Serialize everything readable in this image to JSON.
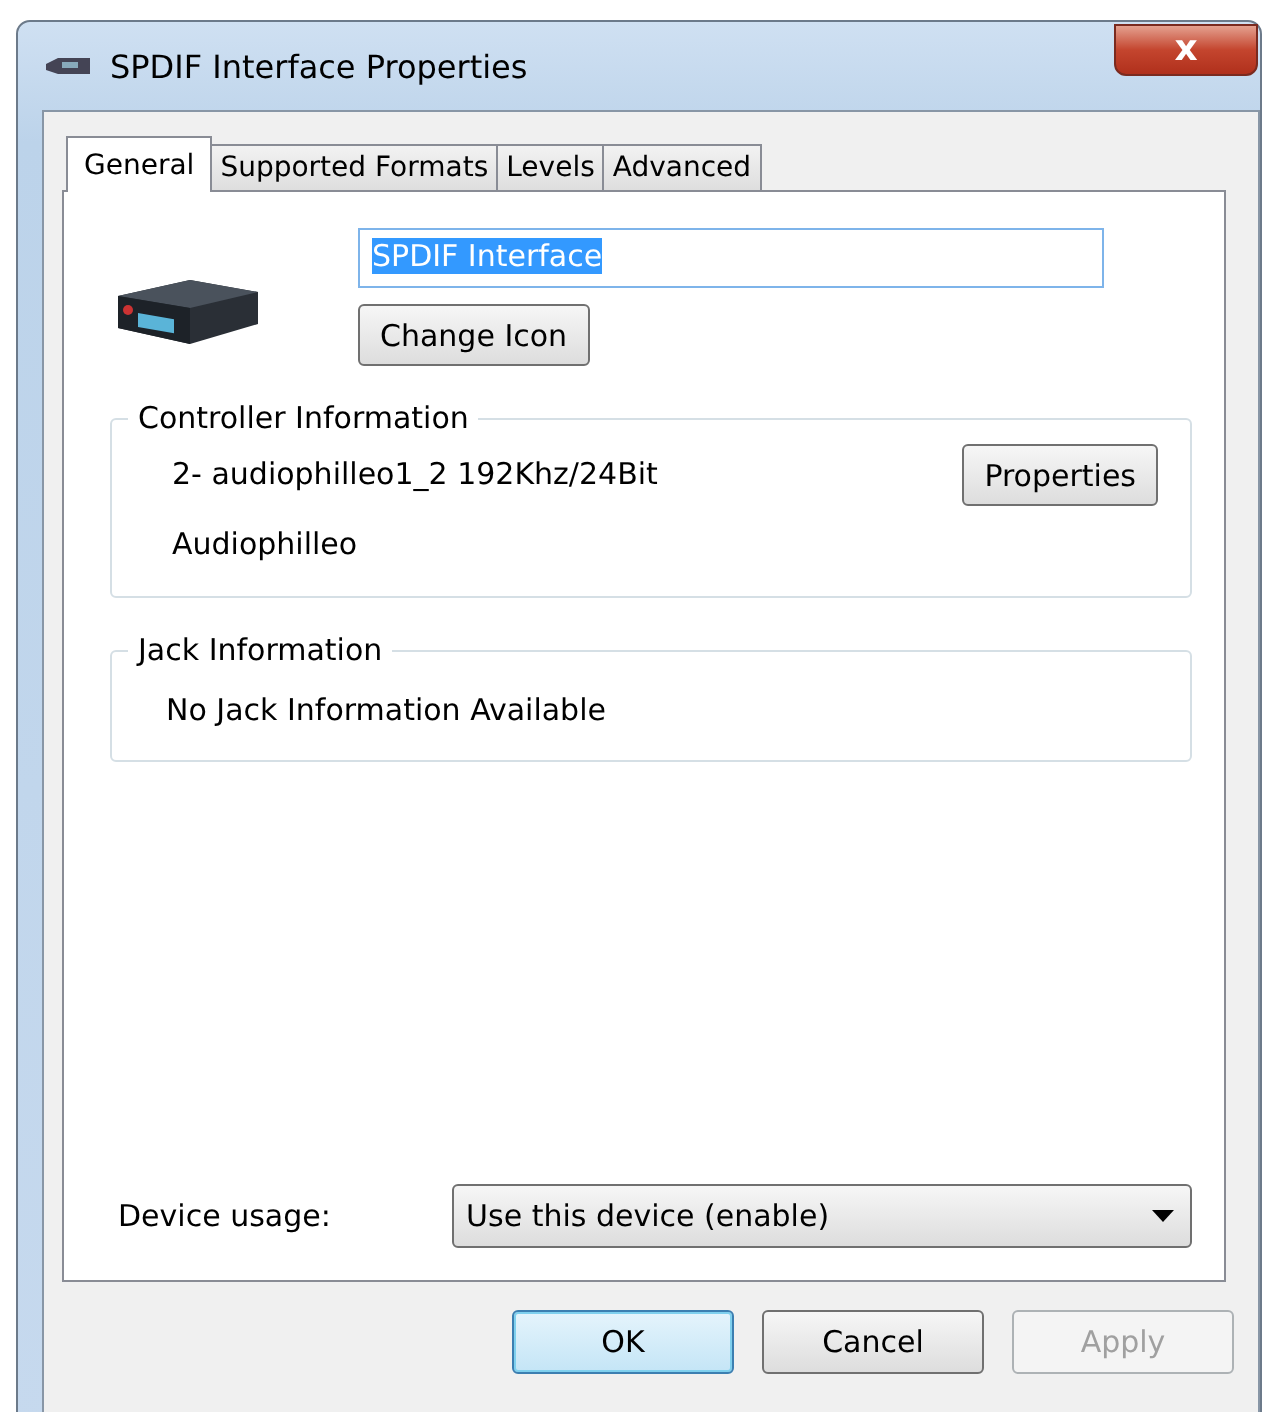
{
  "window": {
    "title": "SPDIF Interface Properties",
    "close": "x"
  },
  "tabs": [
    {
      "label": "General",
      "selected": true
    },
    {
      "label": "Supported Formats",
      "selected": false
    },
    {
      "label": "Levels",
      "selected": false
    },
    {
      "label": "Advanced",
      "selected": false
    }
  ],
  "name_field": {
    "value": "SPDIF Interface",
    "text_selected": true
  },
  "change_icon_button": "Change Icon",
  "controller_information": {
    "title": "Controller Information",
    "lines": [
      "2- audiophilleo1_2 192Khz/24Bit",
      "Audiophilleo"
    ],
    "button": "Properties"
  },
  "jack_information": {
    "title": "Jack Information",
    "lines": [
      "No Jack Information Available"
    ]
  },
  "device_usage": {
    "label": "Device usage:",
    "value": "Use this device (enable)"
  },
  "buttons": [
    {
      "label": "OK",
      "default": true,
      "disabled": false
    },
    {
      "label": "Cancel",
      "default": false,
      "disabled": false
    },
    {
      "label": "Apply",
      "default": false,
      "disabled": true
    }
  ]
}
